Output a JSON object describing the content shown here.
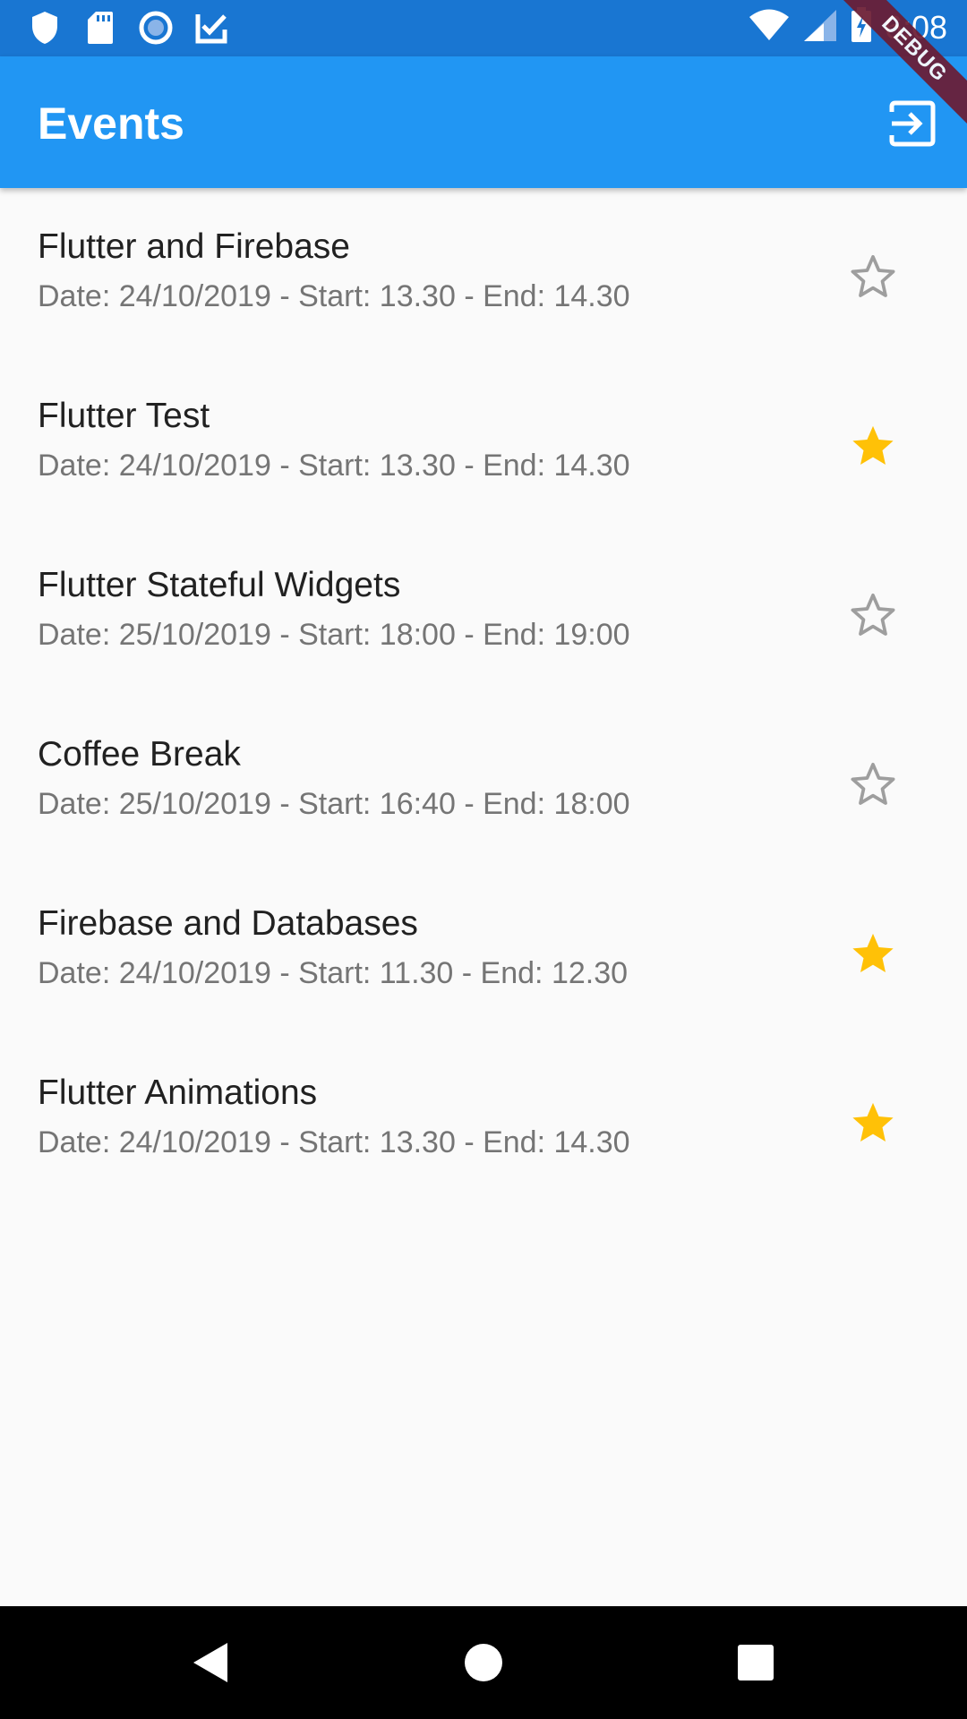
{
  "status_bar": {
    "time": "6:08",
    "icons": [
      "shield-icon",
      "sd-card-icon",
      "radio-icon",
      "checkbox-app-icon",
      "wifi-icon",
      "signal-icon",
      "battery-charging-icon"
    ]
  },
  "app_bar": {
    "title": "Events",
    "action_icon": "exit-to-app-icon"
  },
  "debug_banner": "DEBUG",
  "events": [
    {
      "title": "Flutter and Firebase",
      "subtitle": "Date: 24/10/2019 - Start: 13.30 - End: 14.30",
      "favorite": false
    },
    {
      "title": "Flutter Test",
      "subtitle": "Date: 24/10/2019 - Start: 13.30 - End: 14.30",
      "favorite": true
    },
    {
      "title": "Flutter Stateful Widgets",
      "subtitle": "Date: 25/10/2019 - Start: 18:00 - End: 19:00",
      "favorite": false
    },
    {
      "title": "Coffee Break",
      "subtitle": "Date: 25/10/2019 - Start: 16:40 - End: 18:00",
      "favorite": false
    },
    {
      "title": "Firebase and Databases",
      "subtitle": "Date: 24/10/2019 - Start: 11.30 - End: 12.30",
      "favorite": true
    },
    {
      "title": "Flutter Animations",
      "subtitle": "Date: 24/10/2019 - Start: 13.30 - End: 14.30",
      "favorite": true
    }
  ],
  "colors": {
    "app_bar": "#2196f3",
    "status_bar": "#1976d2",
    "star_filled": "#ffc107",
    "star_outline": "#9e9e9e"
  },
  "nav_bar": {
    "icons": [
      "back-icon",
      "home-icon",
      "recents-icon"
    ]
  }
}
